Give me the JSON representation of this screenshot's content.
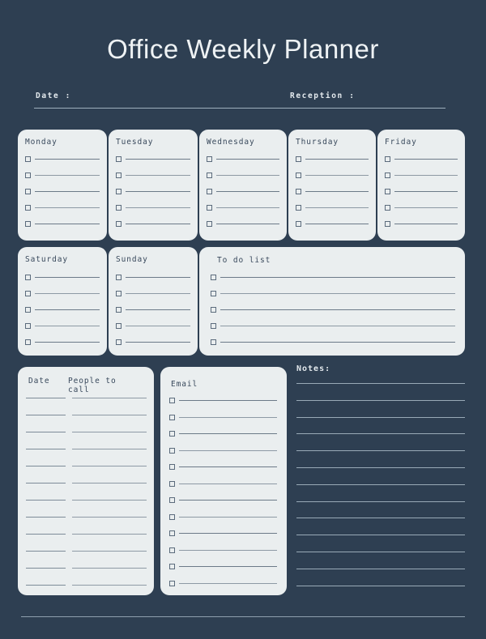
{
  "page": {
    "title": "Office Weekly Planner",
    "background_color": "#2e3f52",
    "card_color": "#eaeeef",
    "rule_color": "#8d99a4",
    "title_color": "#eef2f4"
  },
  "header": {
    "date_label": "Date :",
    "reception_label": "Reception :"
  },
  "weekdays": [
    {
      "title": "Monday",
      "rows": 5
    },
    {
      "title": "Tuesday",
      "rows": 5
    },
    {
      "title": "Wednesday",
      "rows": 5
    },
    {
      "title": "Thursday",
      "rows": 5
    },
    {
      "title": "Friday",
      "rows": 5
    }
  ],
  "weekend": [
    {
      "title": "Saturday",
      "rows": 5
    },
    {
      "title": "Sunday",
      "rows": 5
    }
  ],
  "todo": {
    "title": "To do list",
    "rows": 5
  },
  "people_to_call": {
    "col_date_header": "Date",
    "col_people_header": "People to\ncall",
    "rows": 12
  },
  "email": {
    "title": "Email",
    "rows": 12
  },
  "notes": {
    "title": "Notes:",
    "lines": 13
  }
}
